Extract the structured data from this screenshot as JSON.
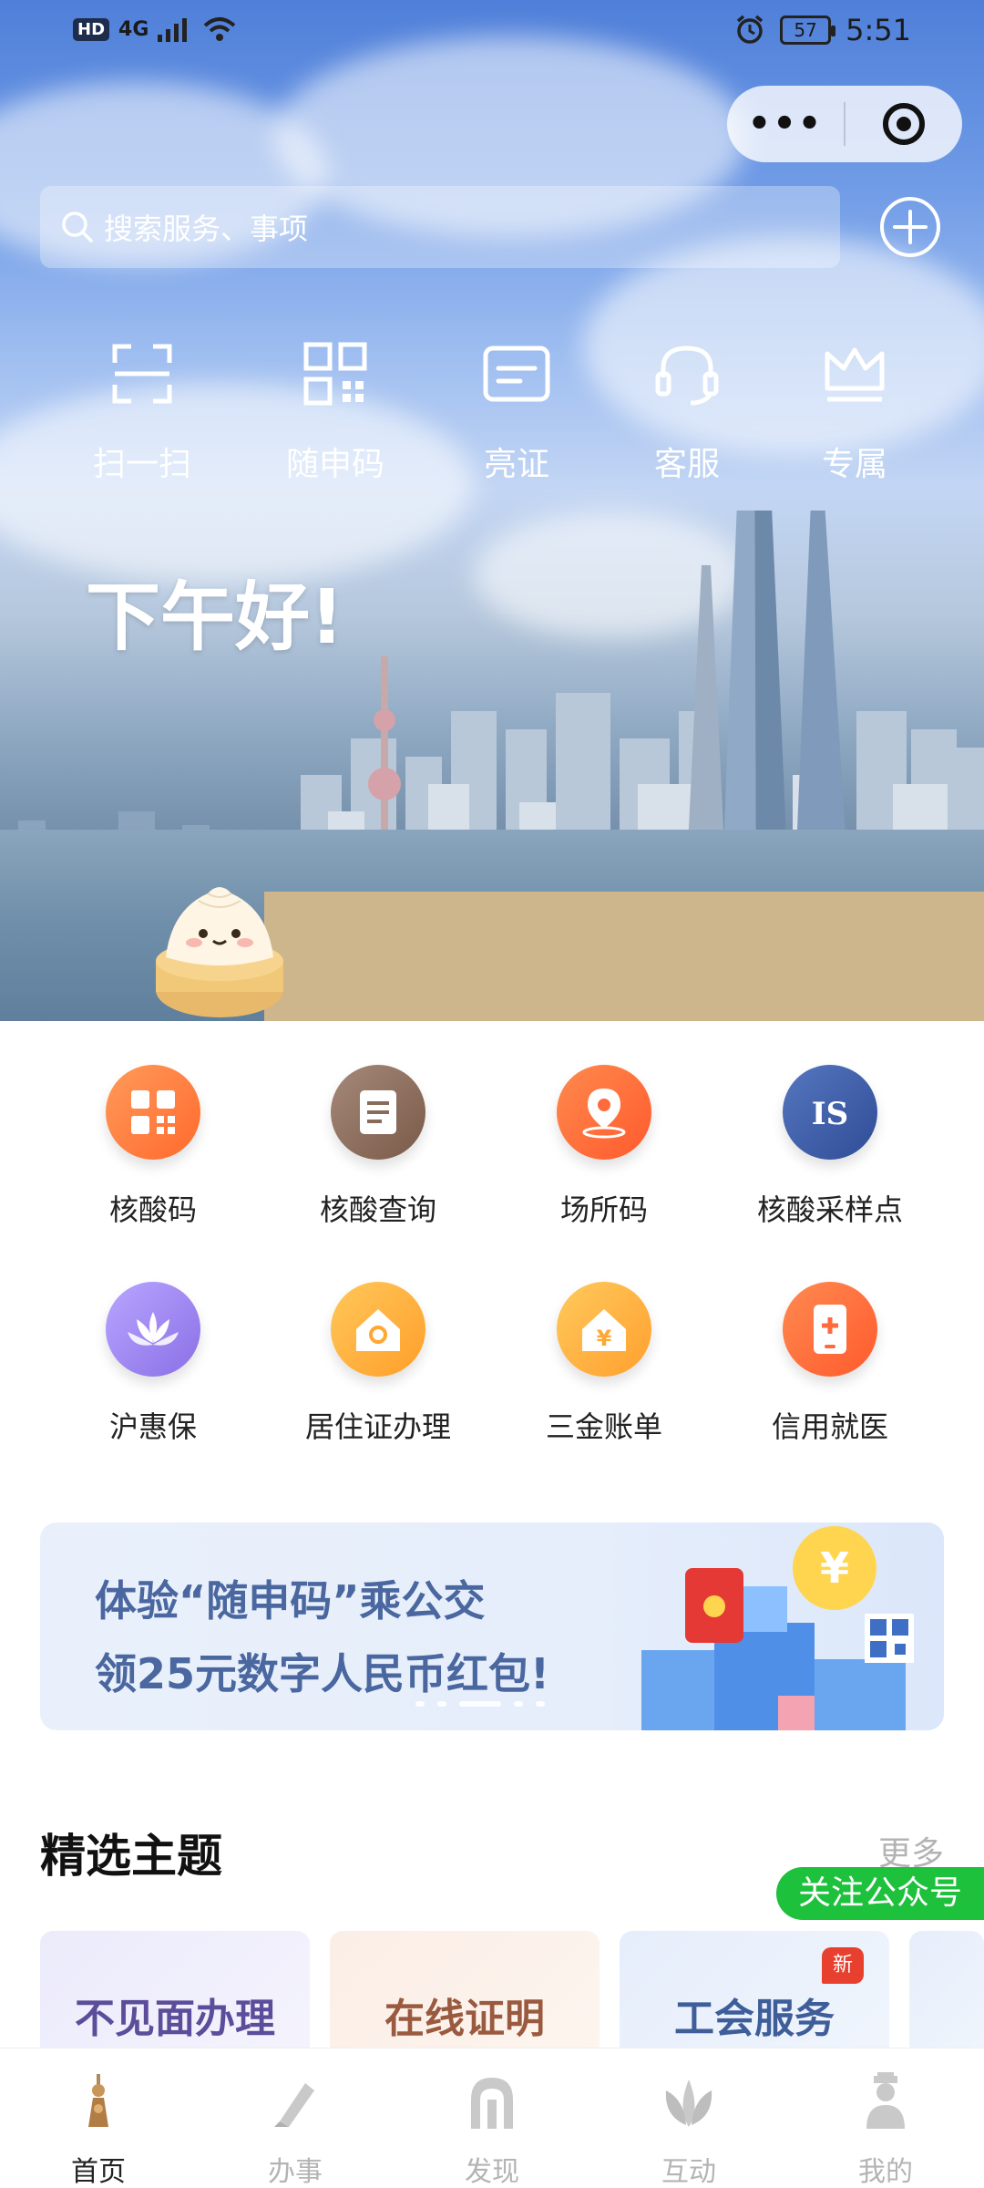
{
  "status_bar": {
    "left_badge": "HD",
    "network": "4G",
    "battery": "57",
    "time": "5:51"
  },
  "capsule": {
    "more_label": "•••",
    "close_icon": "target-icon"
  },
  "search": {
    "placeholder": "搜索服务、事项"
  },
  "quick_actions": [
    {
      "label": "扫一扫",
      "icon": "scan-icon"
    },
    {
      "label": "随申码",
      "icon": "qr-code-icon"
    },
    {
      "label": "亮证",
      "icon": "id-card-icon"
    },
    {
      "label": "客服",
      "icon": "headset-icon"
    },
    {
      "label": "专属",
      "icon": "crown-icon"
    }
  ],
  "greeting": "下午好!",
  "services": [
    {
      "label": "核酸码",
      "icon": "qr-code-icon",
      "color": "#ff7a45"
    },
    {
      "label": "核酸查询",
      "icon": "document-icon",
      "color": "#8a6a58"
    },
    {
      "label": "场所码",
      "icon": "location-pin-icon",
      "color": "#ff6a3d"
    },
    {
      "label": "核酸采样点",
      "icon": "is-logo-icon",
      "color": "#3f5ea8"
    },
    {
      "label": "沪惠保",
      "icon": "lotus-icon",
      "color": "#9b84ee"
    },
    {
      "label": "居住证办理",
      "icon": "house-icon",
      "color": "#ffb03a"
    },
    {
      "label": "三金账单",
      "icon": "yuan-house-icon",
      "color": "#ffb13d"
    },
    {
      "label": "信用就医",
      "icon": "phone-medical-icon",
      "color": "#ff6d3c"
    }
  ],
  "banner": {
    "line1": "体验“随申码”乘公交",
    "line2": "领25元数字人民币红包!"
  },
  "section": {
    "title": "精选主题",
    "more": "更多",
    "follow": "关注公众号",
    "topics": [
      {
        "label": "不见面办理",
        "color": "#5b4d9a"
      },
      {
        "label": "在线证明",
        "color": "#9a5a3f"
      },
      {
        "label": "工会服务",
        "color": "#3e5d99",
        "badge": "新"
      }
    ]
  },
  "tabs": [
    {
      "label": "首页",
      "icon": "pagoda-icon",
      "active": true
    },
    {
      "label": "办事",
      "icon": "pen-icon",
      "active": false
    },
    {
      "label": "发现",
      "icon": "arch-icon",
      "active": false
    },
    {
      "label": "互动",
      "icon": "magnolia-icon",
      "active": false
    },
    {
      "label": "我的",
      "icon": "person-icon",
      "active": false
    }
  ]
}
